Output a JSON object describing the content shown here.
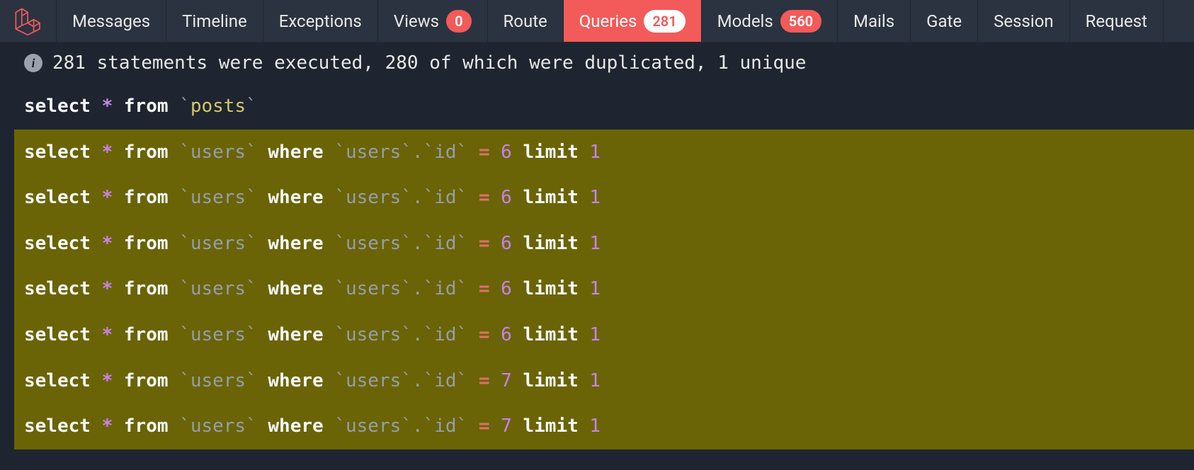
{
  "tabs": {
    "messages": {
      "label": "Messages"
    },
    "timeline": {
      "label": "Timeline"
    },
    "exceptions": {
      "label": "Exceptions"
    },
    "views": {
      "label": "Views",
      "badge": "0"
    },
    "route": {
      "label": "Route"
    },
    "queries": {
      "label": "Queries",
      "badge": "281",
      "active": true
    },
    "models": {
      "label": "Models",
      "badge": "560"
    },
    "mails": {
      "label": "Mails"
    },
    "gate": {
      "label": "Gate"
    },
    "session": {
      "label": "Session"
    },
    "request": {
      "label": "Request"
    }
  },
  "info": {
    "text": "281 statements were executed, 280 of which were duplicated, 1 unique"
  },
  "queries": [
    {
      "duplicated": false,
      "tokens": [
        {
          "cls": "kw",
          "t": "select "
        },
        {
          "cls": "star",
          "t": "*"
        },
        {
          "cls": "kw",
          "t": " from "
        },
        {
          "cls": "tick",
          "t": "`"
        },
        {
          "cls": "tbl",
          "t": "posts"
        },
        {
          "cls": "tick",
          "t": "`"
        }
      ]
    },
    {
      "duplicated": true,
      "tokens": [
        {
          "cls": "kw",
          "t": "select "
        },
        {
          "cls": "star",
          "t": "*"
        },
        {
          "cls": "kw",
          "t": " from "
        },
        {
          "cls": "tick",
          "t": "`"
        },
        {
          "cls": "col",
          "t": "users"
        },
        {
          "cls": "tick",
          "t": "`"
        },
        {
          "cls": "kw",
          "t": " where "
        },
        {
          "cls": "tick",
          "t": "`"
        },
        {
          "cls": "col",
          "t": "users"
        },
        {
          "cls": "tick",
          "t": "`"
        },
        {
          "cls": "col",
          "t": "."
        },
        {
          "cls": "tick",
          "t": "`"
        },
        {
          "cls": "col",
          "t": "id"
        },
        {
          "cls": "tick",
          "t": "`"
        },
        {
          "cls": "kw",
          "t": " "
        },
        {
          "cls": "eq",
          "t": "="
        },
        {
          "cls": "kw",
          "t": " "
        },
        {
          "cls": "num",
          "t": "6"
        },
        {
          "cls": "kw",
          "t": " limit "
        },
        {
          "cls": "num",
          "t": "1"
        }
      ]
    },
    {
      "duplicated": true,
      "tokens": [
        {
          "cls": "kw",
          "t": "select "
        },
        {
          "cls": "star",
          "t": "*"
        },
        {
          "cls": "kw",
          "t": " from "
        },
        {
          "cls": "tick",
          "t": "`"
        },
        {
          "cls": "col",
          "t": "users"
        },
        {
          "cls": "tick",
          "t": "`"
        },
        {
          "cls": "kw",
          "t": " where "
        },
        {
          "cls": "tick",
          "t": "`"
        },
        {
          "cls": "col",
          "t": "users"
        },
        {
          "cls": "tick",
          "t": "`"
        },
        {
          "cls": "col",
          "t": "."
        },
        {
          "cls": "tick",
          "t": "`"
        },
        {
          "cls": "col",
          "t": "id"
        },
        {
          "cls": "tick",
          "t": "`"
        },
        {
          "cls": "kw",
          "t": " "
        },
        {
          "cls": "eq",
          "t": "="
        },
        {
          "cls": "kw",
          "t": " "
        },
        {
          "cls": "num",
          "t": "6"
        },
        {
          "cls": "kw",
          "t": " limit "
        },
        {
          "cls": "num",
          "t": "1"
        }
      ]
    },
    {
      "duplicated": true,
      "tokens": [
        {
          "cls": "kw",
          "t": "select "
        },
        {
          "cls": "star",
          "t": "*"
        },
        {
          "cls": "kw",
          "t": " from "
        },
        {
          "cls": "tick",
          "t": "`"
        },
        {
          "cls": "col",
          "t": "users"
        },
        {
          "cls": "tick",
          "t": "`"
        },
        {
          "cls": "kw",
          "t": " where "
        },
        {
          "cls": "tick",
          "t": "`"
        },
        {
          "cls": "col",
          "t": "users"
        },
        {
          "cls": "tick",
          "t": "`"
        },
        {
          "cls": "col",
          "t": "."
        },
        {
          "cls": "tick",
          "t": "`"
        },
        {
          "cls": "col",
          "t": "id"
        },
        {
          "cls": "tick",
          "t": "`"
        },
        {
          "cls": "kw",
          "t": " "
        },
        {
          "cls": "eq",
          "t": "="
        },
        {
          "cls": "kw",
          "t": " "
        },
        {
          "cls": "num",
          "t": "6"
        },
        {
          "cls": "kw",
          "t": " limit "
        },
        {
          "cls": "num",
          "t": "1"
        }
      ]
    },
    {
      "duplicated": true,
      "tokens": [
        {
          "cls": "kw",
          "t": "select "
        },
        {
          "cls": "star",
          "t": "*"
        },
        {
          "cls": "kw",
          "t": " from "
        },
        {
          "cls": "tick",
          "t": "`"
        },
        {
          "cls": "col",
          "t": "users"
        },
        {
          "cls": "tick",
          "t": "`"
        },
        {
          "cls": "kw",
          "t": " where "
        },
        {
          "cls": "tick",
          "t": "`"
        },
        {
          "cls": "col",
          "t": "users"
        },
        {
          "cls": "tick",
          "t": "`"
        },
        {
          "cls": "col",
          "t": "."
        },
        {
          "cls": "tick",
          "t": "`"
        },
        {
          "cls": "col",
          "t": "id"
        },
        {
          "cls": "tick",
          "t": "`"
        },
        {
          "cls": "kw",
          "t": " "
        },
        {
          "cls": "eq",
          "t": "="
        },
        {
          "cls": "kw",
          "t": " "
        },
        {
          "cls": "num",
          "t": "6"
        },
        {
          "cls": "kw",
          "t": " limit "
        },
        {
          "cls": "num",
          "t": "1"
        }
      ]
    },
    {
      "duplicated": true,
      "tokens": [
        {
          "cls": "kw",
          "t": "select "
        },
        {
          "cls": "star",
          "t": "*"
        },
        {
          "cls": "kw",
          "t": " from "
        },
        {
          "cls": "tick",
          "t": "`"
        },
        {
          "cls": "col",
          "t": "users"
        },
        {
          "cls": "tick",
          "t": "`"
        },
        {
          "cls": "kw",
          "t": " where "
        },
        {
          "cls": "tick",
          "t": "`"
        },
        {
          "cls": "col",
          "t": "users"
        },
        {
          "cls": "tick",
          "t": "`"
        },
        {
          "cls": "col",
          "t": "."
        },
        {
          "cls": "tick",
          "t": "`"
        },
        {
          "cls": "col",
          "t": "id"
        },
        {
          "cls": "tick",
          "t": "`"
        },
        {
          "cls": "kw",
          "t": " "
        },
        {
          "cls": "eq",
          "t": "="
        },
        {
          "cls": "kw",
          "t": " "
        },
        {
          "cls": "num",
          "t": "6"
        },
        {
          "cls": "kw",
          "t": " limit "
        },
        {
          "cls": "num",
          "t": "1"
        }
      ]
    },
    {
      "duplicated": true,
      "tokens": [
        {
          "cls": "kw",
          "t": "select "
        },
        {
          "cls": "star",
          "t": "*"
        },
        {
          "cls": "kw",
          "t": " from "
        },
        {
          "cls": "tick",
          "t": "`"
        },
        {
          "cls": "col",
          "t": "users"
        },
        {
          "cls": "tick",
          "t": "`"
        },
        {
          "cls": "kw",
          "t": " where "
        },
        {
          "cls": "tick",
          "t": "`"
        },
        {
          "cls": "col",
          "t": "users"
        },
        {
          "cls": "tick",
          "t": "`"
        },
        {
          "cls": "col",
          "t": "."
        },
        {
          "cls": "tick",
          "t": "`"
        },
        {
          "cls": "col",
          "t": "id"
        },
        {
          "cls": "tick",
          "t": "`"
        },
        {
          "cls": "kw",
          "t": " "
        },
        {
          "cls": "eq",
          "t": "="
        },
        {
          "cls": "kw",
          "t": " "
        },
        {
          "cls": "num",
          "t": "7"
        },
        {
          "cls": "kw",
          "t": " limit "
        },
        {
          "cls": "num",
          "t": "1"
        }
      ]
    },
    {
      "duplicated": true,
      "tokens": [
        {
          "cls": "kw",
          "t": "select "
        },
        {
          "cls": "star",
          "t": "*"
        },
        {
          "cls": "kw",
          "t": " from "
        },
        {
          "cls": "tick",
          "t": "`"
        },
        {
          "cls": "col",
          "t": "users"
        },
        {
          "cls": "tick",
          "t": "`"
        },
        {
          "cls": "kw",
          "t": " where "
        },
        {
          "cls": "tick",
          "t": "`"
        },
        {
          "cls": "col",
          "t": "users"
        },
        {
          "cls": "tick",
          "t": "`"
        },
        {
          "cls": "col",
          "t": "."
        },
        {
          "cls": "tick",
          "t": "`"
        },
        {
          "cls": "col",
          "t": "id"
        },
        {
          "cls": "tick",
          "t": "`"
        },
        {
          "cls": "kw",
          "t": " "
        },
        {
          "cls": "eq",
          "t": "="
        },
        {
          "cls": "kw",
          "t": " "
        },
        {
          "cls": "num",
          "t": "7"
        },
        {
          "cls": "kw",
          "t": " limit "
        },
        {
          "cls": "num",
          "t": "1"
        }
      ]
    }
  ]
}
